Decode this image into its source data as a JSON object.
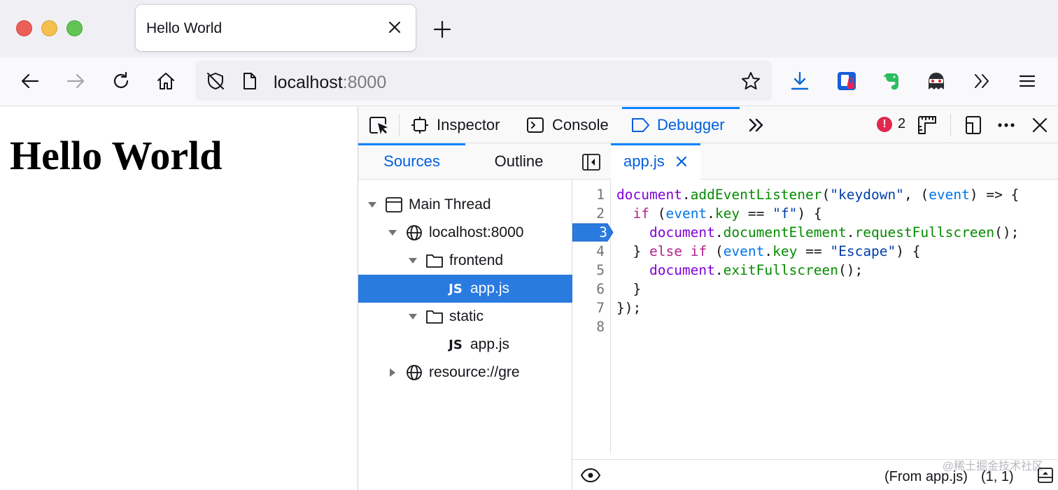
{
  "browser": {
    "tab": {
      "title": "Hello World"
    },
    "url": {
      "host": "localhost",
      "port": ":8000"
    }
  },
  "page": {
    "heading": "Hello World"
  },
  "devtools": {
    "tabs": [
      {
        "label": "Inspector"
      },
      {
        "label": "Console"
      },
      {
        "label": "Debugger"
      }
    ],
    "error_count": "2",
    "sources_tabs": [
      {
        "label": "Sources"
      },
      {
        "label": "Outline"
      }
    ],
    "tree": [
      {
        "label": "Main Thread"
      },
      {
        "label": "localhost:8000"
      },
      {
        "label": "frontend"
      },
      {
        "label": "app.js",
        "type_badge": "JS"
      },
      {
        "label": "static"
      },
      {
        "label": "app.js",
        "type_badge": "JS"
      },
      {
        "label": "resource://gre"
      }
    ],
    "editor": {
      "file_tab": "app.js",
      "breakpoint_line": "3",
      "line_numbers": [
        "1",
        "2",
        "3",
        "4",
        "5",
        "6",
        "7",
        "8"
      ],
      "code_lines": [
        "document.addEventListener(\"keydown\", (event) => {",
        "  if (event.key == \"f\") {",
        "    document.documentElement.requestFullscreen();",
        "  } else if (event.key == \"Escape\") {",
        "    document.exitFullscreen();",
        "  }",
        "});",
        ""
      ],
      "footer_source": "(From app.js)",
      "footer_position": "(1, 1)"
    },
    "watermark": "@稀土掘金技术社区"
  },
  "colors": {
    "accent": "#0a84ff",
    "selected_row": "#2a7be0",
    "error": "#e22850"
  }
}
